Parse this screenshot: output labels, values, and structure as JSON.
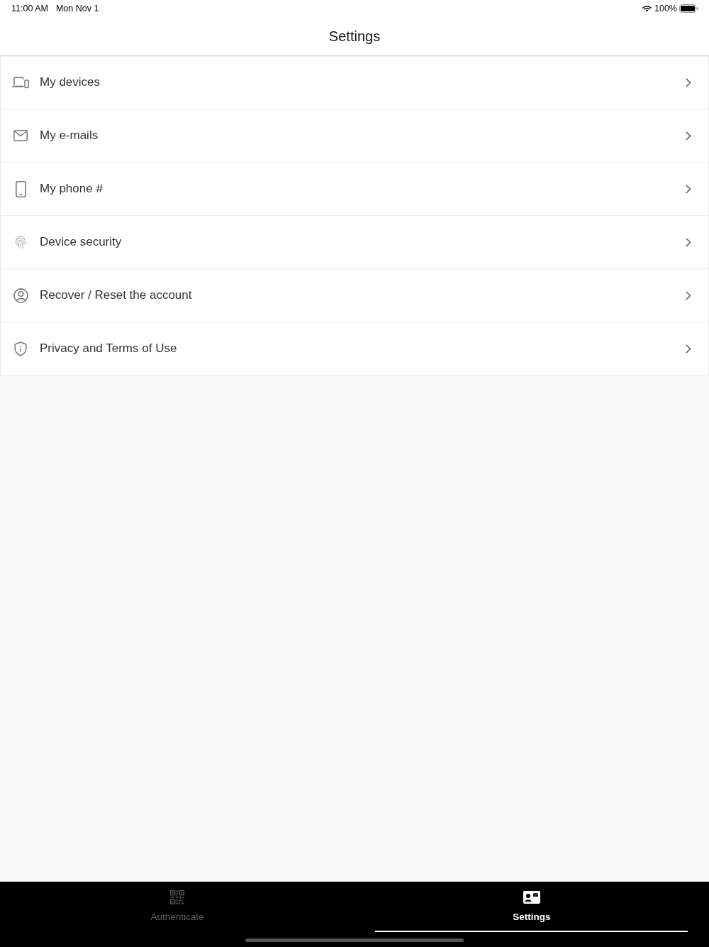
{
  "status_bar": {
    "time": "11:00 AM",
    "date": "Mon Nov 1",
    "battery": "100%"
  },
  "header": {
    "title": "Settings"
  },
  "settings_items": [
    {
      "label": "My devices"
    },
    {
      "label": "My e-mails"
    },
    {
      "label": "My phone #"
    },
    {
      "label": "Device security"
    },
    {
      "label": "Recover / Reset the account"
    },
    {
      "label": "Privacy and Terms of Use"
    }
  ],
  "tab_bar": {
    "tabs": [
      {
        "label": "Authenticate",
        "selected": false
      },
      {
        "label": "Settings",
        "selected": true
      }
    ]
  }
}
